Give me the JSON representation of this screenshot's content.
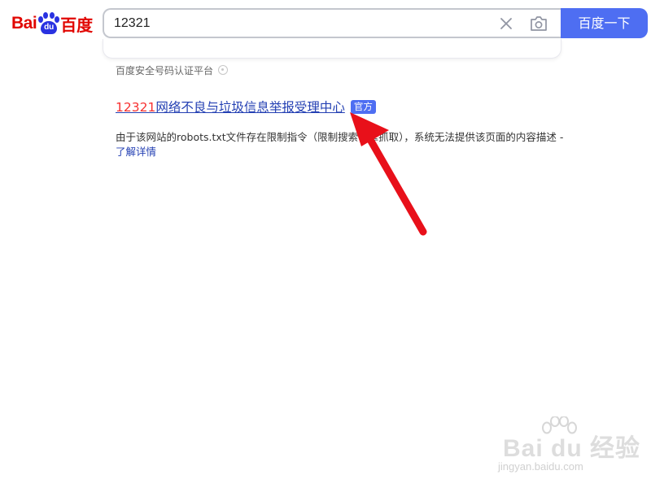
{
  "header": {
    "logo": {
      "text_left": "Bai",
      "text_paw": "du",
      "text_right": "百度"
    },
    "search": {
      "value": "12321",
      "clear_icon": "close-icon",
      "camera_icon": "camera-icon"
    },
    "search_button_label": "百度一下"
  },
  "result": {
    "source_label": "百度安全号码认证平台",
    "title_highlight": "12321",
    "title_rest": "网络不良与垃圾信息举报受理中心",
    "badge": "官方",
    "snippet": "由于该网站的robots.txt文件存在限制指令（限制搜索引擎抓取），系统无法提供该页面的内容描述 - ",
    "more_link": "了解详情"
  },
  "watermark": {
    "main": "Bai du 经验",
    "url": "jingyan.baidu.com"
  },
  "colors": {
    "brand_blue": "#4e6ef2",
    "link_blue": "#2440b3",
    "highlight_red": "#f73131",
    "logo_red": "#e10601",
    "arrow_red": "#e8101a"
  }
}
